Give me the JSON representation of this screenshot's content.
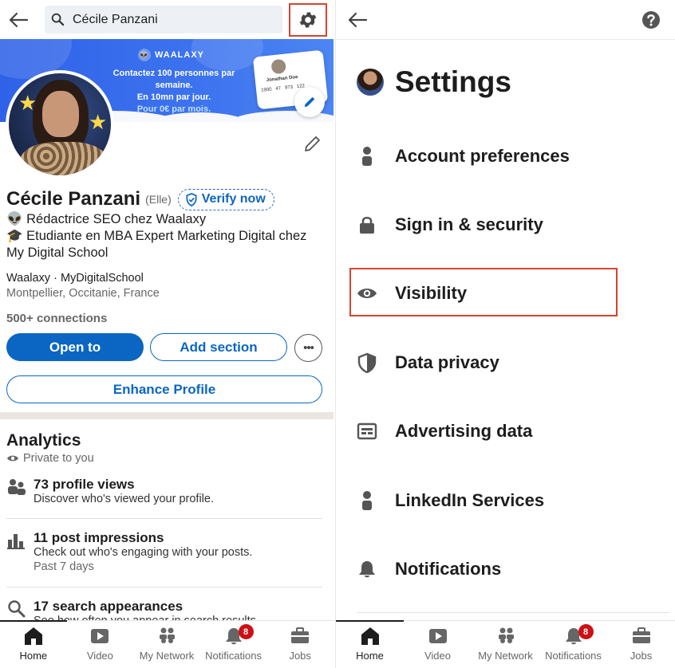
{
  "left": {
    "search": {
      "value": "Cécile Panzani"
    },
    "banner": {
      "brand": "WAALAXY",
      "line1": "Contactez 100 personnes par semaine.",
      "line2": "En 10mn par jour.",
      "line3": "Pour 0€ par mois.",
      "card_name": "Jonathan Doe",
      "card_stats": [
        "1900",
        "47",
        "973"
      ],
      "card_extra": "122"
    },
    "profile": {
      "name": "Cécile Panzani",
      "pronoun": "(Elle)",
      "verify_label": "Verify now",
      "headline_line1": "👽 Rédactrice SEO chez Waalaxy",
      "headline_line2": "🎓 Etudiante en MBA Expert Marketing Digital chez My Digital School",
      "education": "Waalaxy  · MyDigitalSchool",
      "location": "Montpellier, Occitanie, France",
      "connections": "500+ connections"
    },
    "buttons": {
      "open_to": "Open to",
      "add_section": "Add section",
      "more": "•••",
      "enhance": "Enhance Profile"
    },
    "analytics": {
      "title": "Analytics",
      "private": "Private to you",
      "items": [
        {
          "title": "73 profile views",
          "desc": "Discover who's viewed your profile.",
          "sub": ""
        },
        {
          "title": "11 post impressions",
          "desc": "Check out who's engaging with your posts.",
          "sub": "Past 7 days"
        },
        {
          "title": "17 search appearances",
          "desc": "See how often you appear in search results.",
          "sub": ""
        }
      ]
    }
  },
  "nav": {
    "items": [
      {
        "label": "Home",
        "icon": "home-icon"
      },
      {
        "label": "Video",
        "icon": "video-icon"
      },
      {
        "label": "My Network",
        "icon": "network-icon"
      },
      {
        "label": "Notifications",
        "icon": "bell-icon",
        "badge": "8"
      },
      {
        "label": "Jobs",
        "icon": "briefcase-icon"
      }
    ]
  },
  "settings": {
    "title": "Settings",
    "items": [
      {
        "label": "Account preferences",
        "icon": "person-icon"
      },
      {
        "label": "Sign in & security",
        "icon": "lock-icon"
      },
      {
        "label": "Visibility",
        "icon": "eye-icon"
      },
      {
        "label": "Data privacy",
        "icon": "shield-icon"
      },
      {
        "label": "Advertising data",
        "icon": "ad-icon"
      },
      {
        "label": "LinkedIn Services",
        "icon": "person-icon"
      },
      {
        "label": "Notifications",
        "icon": "bell-icon"
      }
    ]
  },
  "colors": {
    "linkedin_blue": "#0a66c2",
    "highlight": "#d6442f",
    "badge": "#cc1016"
  }
}
